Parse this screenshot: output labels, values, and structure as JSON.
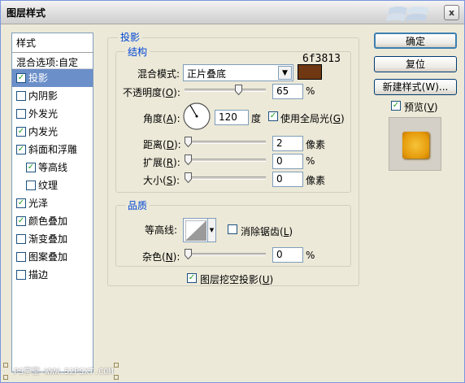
{
  "window": {
    "title": "图层样式",
    "close": "x"
  },
  "styles_panel": {
    "header": "样式",
    "blend_options": "混合选项:自定",
    "items": [
      {
        "label": "投影",
        "checked": true,
        "selected": true,
        "sub": false
      },
      {
        "label": "内阴影",
        "checked": false,
        "selected": false,
        "sub": false
      },
      {
        "label": "外发光",
        "checked": false,
        "selected": false,
        "sub": false
      },
      {
        "label": "内发光",
        "checked": true,
        "selected": false,
        "sub": false
      },
      {
        "label": "斜面和浮雕",
        "checked": true,
        "selected": false,
        "sub": false
      },
      {
        "label": "等高线",
        "checked": true,
        "selected": false,
        "sub": true
      },
      {
        "label": "纹理",
        "checked": false,
        "selected": false,
        "sub": true
      },
      {
        "label": "光泽",
        "checked": true,
        "selected": false,
        "sub": false
      },
      {
        "label": "颜色叠加",
        "checked": true,
        "selected": false,
        "sub": false
      },
      {
        "label": "渐变叠加",
        "checked": false,
        "selected": false,
        "sub": false
      },
      {
        "label": "图案叠加",
        "checked": false,
        "selected": false,
        "sub": false
      },
      {
        "label": "描边",
        "checked": false,
        "selected": false,
        "sub": false
      }
    ]
  },
  "shadow": {
    "title": "投影",
    "structure": {
      "title": "结构",
      "blend_mode_label": "混合模式:",
      "blend_mode_value": "正片叠底",
      "color_hex": "6f3813",
      "color": "#6f3813",
      "opacity_label": "不透明度(",
      "opacity_key": "O",
      "opacity_value": "65",
      "opacity_unit": "%",
      "angle_label": "角度(",
      "angle_key": "A",
      "angle_value": "120",
      "angle_unit": "度",
      "global_light_label": "使用全局光(",
      "global_light_key": "G",
      "distance_label": "距离(",
      "distance_key": "D",
      "distance_value": "2",
      "distance_unit": "像素",
      "spread_label": "扩展(",
      "spread_key": "R",
      "spread_value": "0",
      "spread_unit": "%",
      "size_label": "大小(",
      "size_key": "S",
      "size_value": "0",
      "size_unit": "像素"
    },
    "quality": {
      "title": "品质",
      "contour_label": "等高线:",
      "antialias_label": "消除锯齿(",
      "antialias_key": "L",
      "noise_label": "杂色(",
      "noise_key": "N",
      "noise_value": "0",
      "noise_unit": "%"
    },
    "knockout_label": "图层挖空投影(",
    "knockout_key": "U"
  },
  "buttons": {
    "ok": "确定",
    "reset": "复位",
    "new_style": "新建样式(W)...",
    "preview_label": "预览(",
    "preview_key": "V"
  },
  "watermark": "PS学堂·WWW.52PSXT.COM",
  "close_paren": "):",
  "close_paren2": ")",
  "colors": {
    "selection": "#6b8fc9",
    "group_title": "#0046d5",
    "preview_fill": "#e59a0a"
  }
}
